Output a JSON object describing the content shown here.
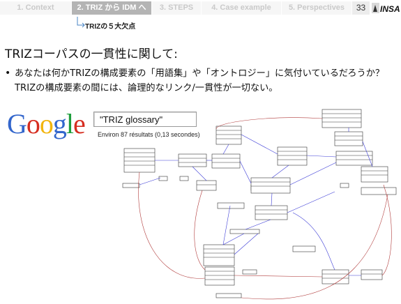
{
  "nav": {
    "tabs": [
      {
        "label": "1. Context",
        "active": false
      },
      {
        "label": "2. TRIZ から IDM へ",
        "active": true
      },
      {
        "label": "3. STEPS",
        "active": false
      },
      {
        "label": "4. Case example",
        "active": false
      },
      {
        "label": "5. Perspectives",
        "active": false
      }
    ],
    "page_number": "33",
    "logo_text": "INSA",
    "active_color": "#b4b4b4",
    "inactive_color": "#f6f6f6"
  },
  "subnav": {
    "label": "TRIZの５大欠点",
    "arrow_color": "#4a86c5"
  },
  "slide": {
    "title": "TRIZコーパスの一貫性に関して:",
    "bullet": "あなたは何かTRIZの構成要素の「用語集」や「オントロジー」に気付いているだろうか？ TRIZの構成要素の間には、論理的なリンク/一貫性が一切ない。"
  },
  "search": {
    "logo": [
      "G",
      "o",
      "o",
      "g",
      "l",
      "e"
    ],
    "logo_colors": [
      "#3366cc",
      "#d62d20",
      "#f2b50f",
      "#3366cc",
      "#1e9e3b",
      "#d62d20"
    ],
    "query": "\"TRIZ glossary\"",
    "result_count": "Environ 87 résultats (0,13 secondes)"
  },
  "diagram": {
    "link_color_blue": "#3b3bd6",
    "link_color_red": "#b03a3a"
  }
}
